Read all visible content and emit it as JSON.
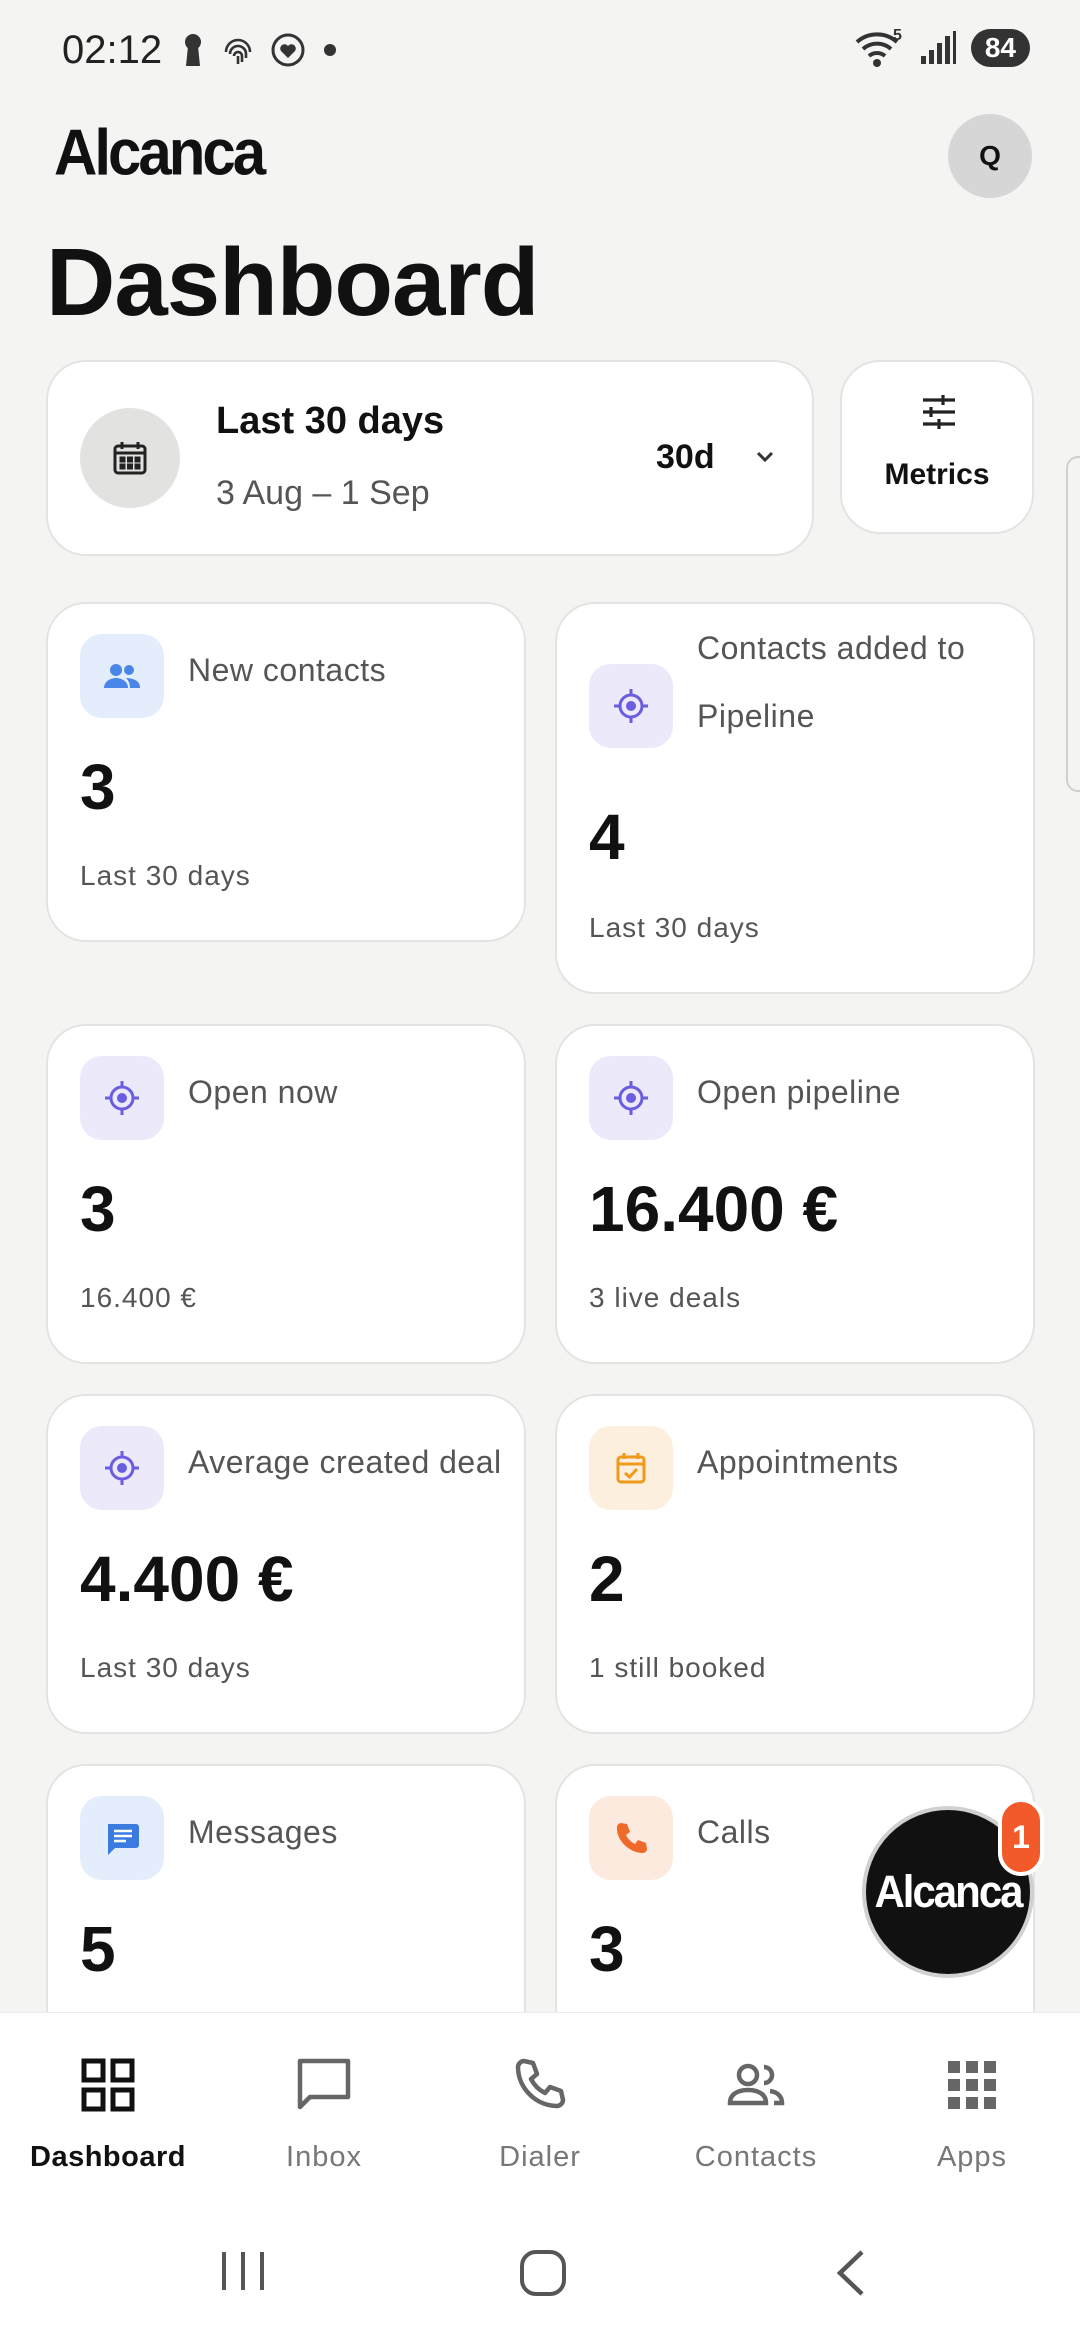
{
  "status_bar": {
    "time": "02:12",
    "wifi_label": "5",
    "battery": "84"
  },
  "header": {
    "logo": "Alcanca",
    "avatar_initial": "Q",
    "title": "Dashboard"
  },
  "range": {
    "label": "Last 30 days",
    "dates": "3 Aug – 1 Sep",
    "short": "30d"
  },
  "metrics_button": {
    "label": "Metrics"
  },
  "cards": [
    {
      "label": "New contacts",
      "value": "3",
      "note": "Last 30 days",
      "icon": "people-icon",
      "tint": "#e3edfb",
      "color": "#4a86e8"
    },
    {
      "label": "Contacts added to Pipeline",
      "value": "4",
      "note": "Last 30 days",
      "icon": "target-icon",
      "tint": "#ece9fb",
      "color": "#6b5de0"
    },
    {
      "label": "Open now",
      "value": "3",
      "note": "16.400 €",
      "icon": "target-icon",
      "tint": "#ece9fb",
      "color": "#6b5de0"
    },
    {
      "label": "Open pipeline",
      "value": "16.400 €",
      "note": "3 live deals",
      "icon": "target-icon",
      "tint": "#ece9fb",
      "color": "#6b5de0"
    },
    {
      "label": "Average created deal",
      "value": "4.400 €",
      "note": "Last 30 days",
      "icon": "target-icon",
      "tint": "#ece9fb",
      "color": "#6b5de0"
    },
    {
      "label": "Appointments",
      "value": "2",
      "note": "1 still booked",
      "icon": "calendar-check-icon",
      "tint": "#fdefdd",
      "color": "#ef9a1a"
    },
    {
      "label": "Messages",
      "value": "5",
      "note": "",
      "icon": "message-icon",
      "tint": "#e3edfb",
      "color": "#3b7be0"
    },
    {
      "label": "Calls",
      "value": "3",
      "note": "",
      "icon": "phone-icon",
      "tint": "#fdeadf",
      "color": "#ef6a2a"
    }
  ],
  "fab": {
    "logo": "Alcanca",
    "badge": "1"
  },
  "bottom_nav": [
    {
      "label": "Dashboard",
      "active": true
    },
    {
      "label": "Inbox",
      "active": false
    },
    {
      "label": "Dialer",
      "active": false
    },
    {
      "label": "Contacts",
      "active": false
    },
    {
      "label": "Apps",
      "active": false
    }
  ]
}
